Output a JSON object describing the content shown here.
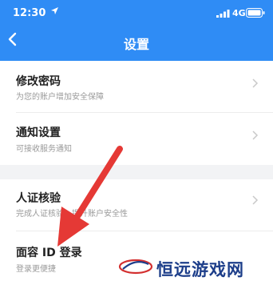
{
  "status_bar": {
    "time": "12:30",
    "network": "4G",
    "icons": [
      "location-arrow-icon",
      "signal-icon",
      "battery-icon"
    ]
  },
  "header": {
    "title": "设置",
    "back_icon": "chevron-left-icon",
    "background_color": "#2f8cf5"
  },
  "settings": {
    "items": [
      {
        "label": "修改密码",
        "description": "为您的账户增加安全保障"
      },
      {
        "label": "通知设置",
        "description": "可接收服务通知"
      },
      {
        "label": "人证核验",
        "description": "完成人证核验，提升账户安全性"
      },
      {
        "label": "面容 ID 登录",
        "description": "登录更便捷"
      }
    ]
  },
  "annotation": {
    "type": "red-arrow-icon",
    "color": "#e53935"
  },
  "watermark": {
    "text": "恒远游戏网",
    "logo": "watermark-logo-icon"
  }
}
